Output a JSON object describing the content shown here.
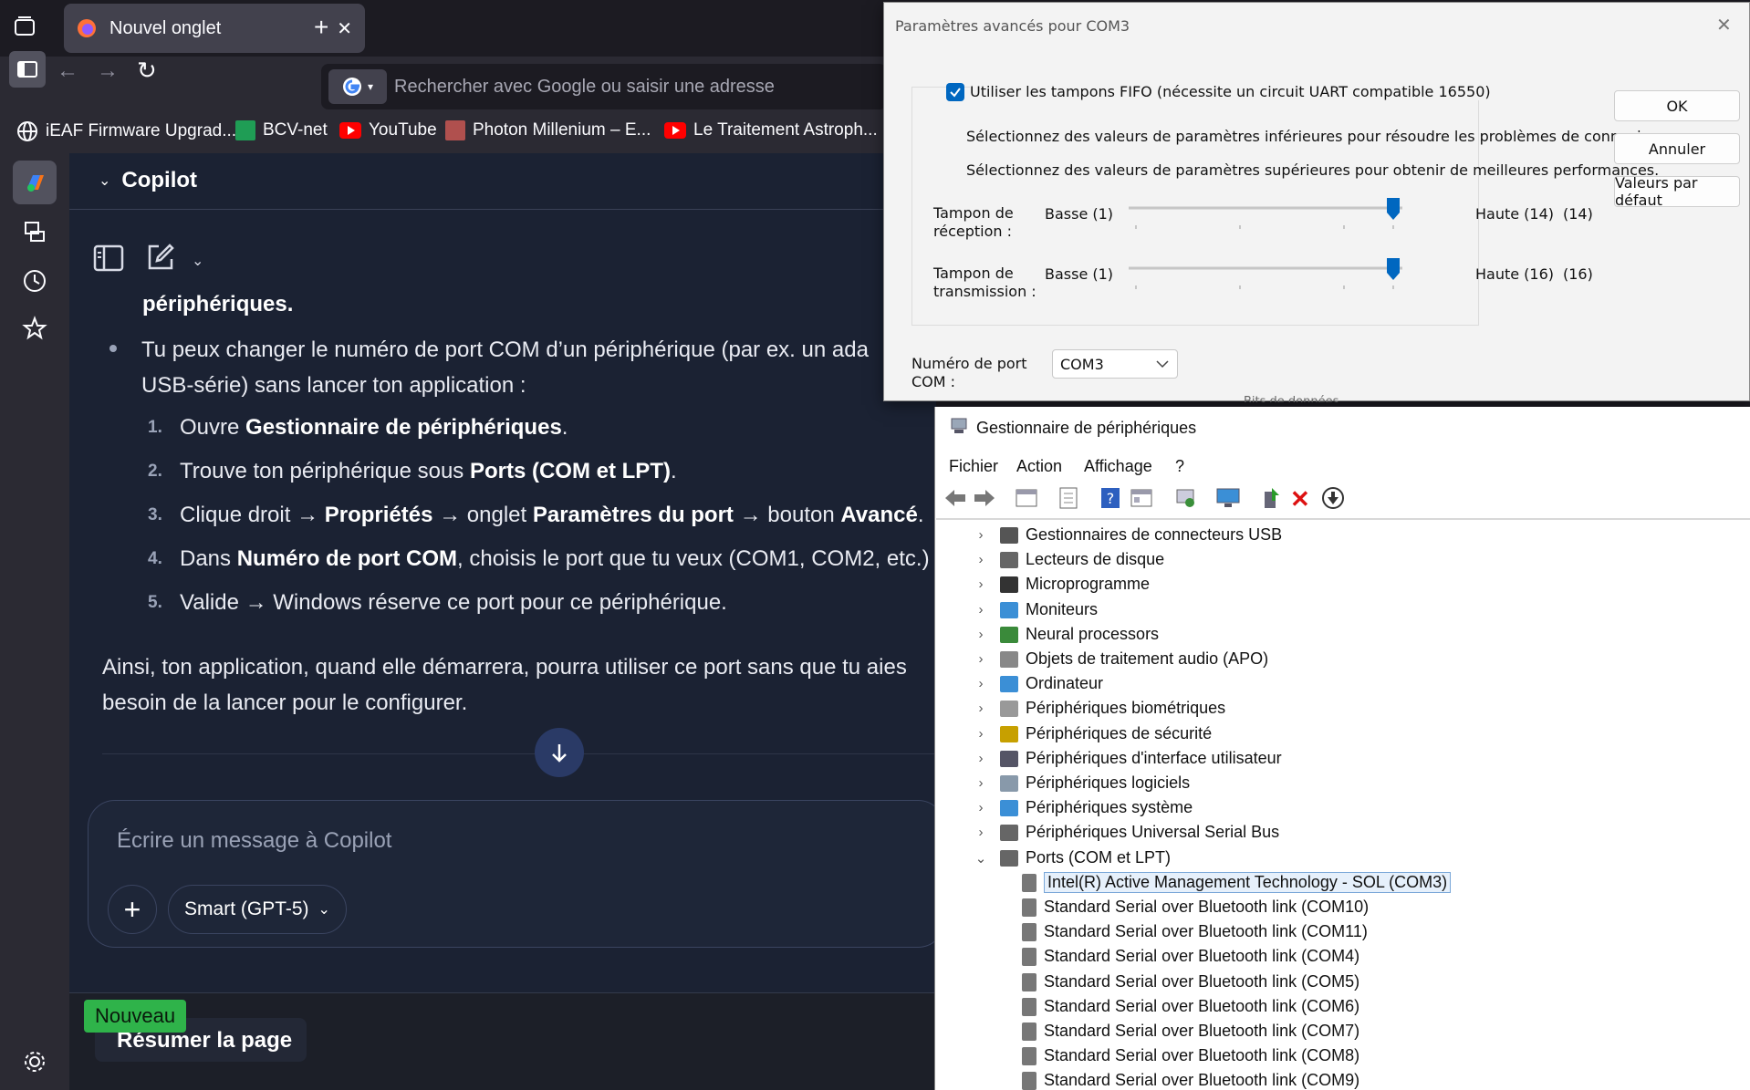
{
  "browser": {
    "tab_title": "Nouvel onglet",
    "address_placeholder": "Rechercher avec Google ou saisir une adresse",
    "bookmarks": [
      "iEAF Firmware Upgrad...",
      "BCV-net",
      "YouTube",
      "Photon Millenium – E...",
      "Le Traitement Astroph..."
    ]
  },
  "copilot": {
    "header_title": "Copilot",
    "partial_top": "périphériques.",
    "bullet_line1": "Tu peux changer le numéro de port COM d’un périphérique (par ex. un ada",
    "bullet_line2": "USB-série) sans lancer ton application :",
    "steps": [
      {
        "num": "1.",
        "parts": [
          {
            "t": "Ouvre ",
            "b": false
          },
          {
            "t": "Gestionnaire de périphériques",
            "b": true
          },
          {
            "t": ".",
            "b": false
          }
        ]
      },
      {
        "num": "2.",
        "parts": [
          {
            "t": "Trouve ton périphérique sous ",
            "b": false
          },
          {
            "t": "Ports (COM et LPT)",
            "b": true
          },
          {
            "t": ".",
            "b": false
          }
        ]
      },
      {
        "num": "3.",
        "parts": [
          {
            "t": "Clique droit → ",
            "b": false
          },
          {
            "t": "Propriétés",
            "b": true
          },
          {
            "t": " → onglet ",
            "b": false
          },
          {
            "t": "Paramètres du port",
            "b": true
          },
          {
            "t": " → bouton ",
            "b": false
          },
          {
            "t": "Avancé",
            "b": true
          },
          {
            "t": ".",
            "b": false
          }
        ]
      },
      {
        "num": "4.",
        "parts": [
          {
            "t": "Dans ",
            "b": false
          },
          {
            "t": "Numéro de port COM",
            "b": true
          },
          {
            "t": ", choisis le port que tu veux (COM1, COM2, etc.)",
            "b": false
          }
        ]
      },
      {
        "num": "5.",
        "parts": [
          {
            "t": "Valide → Windows réserve ce port pour ce périphérique.",
            "b": false
          }
        ]
      }
    ],
    "conclusion_line1": "Ainsi, ton application, quand elle démarrera, pourra utiliser ce port sans que tu aies",
    "conclusion_line2": "besoin de la lancer pour le configurer.",
    "composer_placeholder": "Écrire un message à Copilot",
    "model_label": "Smart (GPT-5)",
    "new_badge": "Nouveau",
    "summarize_label": "Résumer la page"
  },
  "dialog": {
    "title": "Paramètres avancés pour COM3",
    "fifo_label": "Utiliser les tampons FIFO (nécessite un circuit UART compatible 16550)",
    "fifo_checked": true,
    "hint_low": "Sélectionnez des valeurs de paramètres inférieures pour résoudre les problèmes de connexions.",
    "hint_high": "Sélectionnez des valeurs de paramètres supérieures pour obtenir de meilleures performances.",
    "rx_label_1": "Tampon de",
    "rx_label_2": "réception :",
    "rx_low": "Basse (1)",
    "rx_high": "Haute (14)",
    "rx_value": "(14)",
    "rx_level": 1.0,
    "tx_label_1": "Tampon de",
    "tx_label_2": "transmission :",
    "tx_low": "Basse (1)",
    "tx_high": "Haute (16)",
    "tx_value": "(16)",
    "tx_level": 1.0,
    "port_label_1": "Numéro de port",
    "port_label_2": "COM :",
    "port_value": "COM3",
    "ok": "OK",
    "cancel": "Annuler",
    "defaults": "Valeurs par défaut",
    "behind_text": "Bits de données"
  },
  "devmgr": {
    "title": "Gestionnaire de périphériques",
    "menu": [
      "Fichier",
      "Action",
      "Affichage",
      "?"
    ],
    "categories": [
      "Gestionnaires de connecteurs USB",
      "Lecteurs de disque",
      "Microprogramme",
      "Moniteurs",
      "Neural processors",
      "Objets de traitement audio (APO)",
      "Ordinateur",
      "Périphériques biométriques",
      "Périphériques de sécurité",
      "Périphériques d'interface utilisateur",
      "Périphériques logiciels",
      "Périphériques système",
      "Périphériques Universal Serial Bus",
      "Ports (COM et LPT)"
    ],
    "ports": [
      "Intel(R) Active Management Technology - SOL (COM3)",
      "Standard Serial over Bluetooth link (COM10)",
      "Standard Serial over Bluetooth link (COM11)",
      "Standard Serial over Bluetooth link (COM4)",
      "Standard Serial over Bluetooth link (COM5)",
      "Standard Serial over Bluetooth link (COM6)",
      "Standard Serial over Bluetooth link (COM7)",
      "Standard Serial over Bluetooth link (COM8)",
      "Standard Serial over Bluetooth link (COM9)"
    ]
  },
  "colors": {
    "accent_blue": "#0067c0",
    "new_badge": "#2fb34a",
    "copilot_bg": "#1b2233",
    "chrome_bg": "#2b2a33"
  }
}
